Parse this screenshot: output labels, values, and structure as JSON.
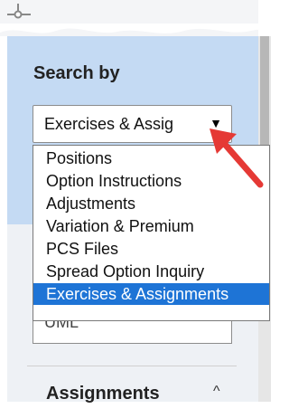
{
  "search": {
    "title": "Search by",
    "selected_value": "Exercises & Assig",
    "caret": "▼"
  },
  "dropdown": {
    "options": [
      "Positions",
      "Option Instructions",
      "Adjustments",
      "Variation & Premium",
      "PCS Files",
      "Spread Option Inquiry",
      "Exercises & Assignments"
    ],
    "selected_index": 6
  },
  "partial_field": {
    "text": "UML"
  },
  "section": {
    "label": "Assignments",
    "chevron": "^"
  },
  "colors": {
    "panel": "#c4daf3",
    "selected_option": "#1e74d6",
    "arrow": "#e53935"
  },
  "icons": [
    "slider-icon",
    "caret-down-icon",
    "chevron-up-icon",
    "red-arrow-annotation"
  ]
}
